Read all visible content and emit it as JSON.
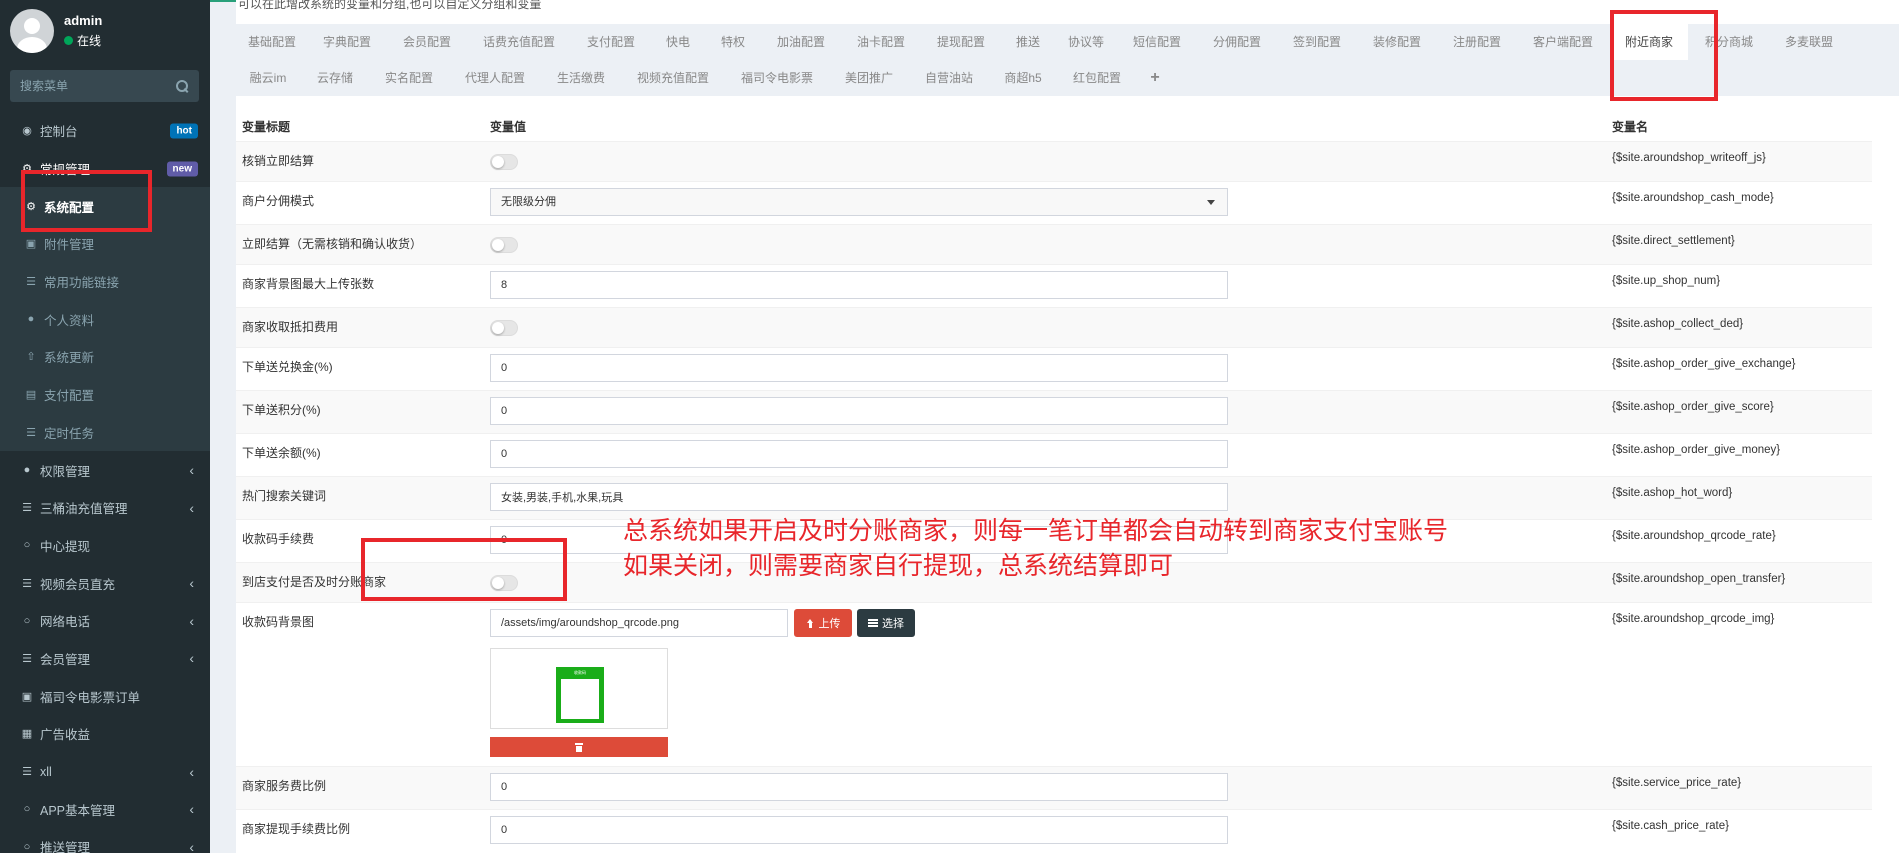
{
  "user": {
    "name": "admin",
    "status": "在线"
  },
  "search": {
    "placeholder": "搜索菜单"
  },
  "menu": [
    {
      "label": "控制台",
      "badge": "hot"
    },
    {
      "label": "常规管理",
      "badge": "new"
    },
    {
      "label": "系统配置"
    },
    {
      "label": "附件管理"
    },
    {
      "label": "常用功能链接"
    },
    {
      "label": "个人资料"
    },
    {
      "label": "系统更新"
    },
    {
      "label": "支付配置"
    },
    {
      "label": "定时任务"
    },
    {
      "label": "权限管理"
    },
    {
      "label": "三桶油充值管理"
    },
    {
      "label": "中心提现"
    },
    {
      "label": "视频会员直充"
    },
    {
      "label": "网络电话"
    },
    {
      "label": "会员管理"
    },
    {
      "label": "福司令电影票订单"
    },
    {
      "label": "广告收益"
    },
    {
      "label": "xll"
    },
    {
      "label": "APP基本管理"
    },
    {
      "label": "推送管理"
    }
  ],
  "page": {
    "description": "可以在此增改系统的变量和分组,也可以自定义分组和变量"
  },
  "tabs": [
    "基础配置",
    "字典配置",
    "会员配置",
    "话费充值配置",
    "支付配置",
    "快电",
    "特权",
    "加油配置",
    "油卡配置",
    "提现配置",
    "推送",
    "协议等",
    "短信配置",
    "分佣配置",
    "签到配置",
    "装修配置",
    "注册配置",
    "客户端配置",
    "附近商家",
    "积分商城",
    "多麦联盟",
    "融云im",
    "云存储",
    "实名配置",
    "代理人配置",
    "生活缴费",
    "视频充值配置",
    "福司令电影票",
    "美团推广",
    "自营油站",
    "商超h5",
    "红包配置",
    "+"
  ],
  "table": {
    "headers": {
      "title": "变量标题",
      "value": "变量值",
      "name": "变量名"
    },
    "rows": [
      {
        "title": "核销立即结算",
        "type": "toggle",
        "name": "{$site.aroundshop_writeoff_js}"
      },
      {
        "title": "商户分佣模式",
        "type": "select",
        "value": "无限级分佣",
        "name": "{$site.aroundshop_cash_mode}"
      },
      {
        "title": "立即结算（无需核销和确认收货）",
        "type": "toggle",
        "name": "{$site.direct_settlement}"
      },
      {
        "title": "商家背景图最大上传张数",
        "type": "input",
        "value": "8",
        "name": "{$site.up_shop_num}"
      },
      {
        "title": "商家收取抵扣费用",
        "type": "toggle",
        "name": "{$site.ashop_collect_ded}"
      },
      {
        "title": "下单送兑换金(%)",
        "type": "input",
        "value": "0",
        "name": "{$site.ashop_order_give_exchange}"
      },
      {
        "title": "下单送积分(%)",
        "type": "input",
        "value": "0",
        "name": "{$site.ashop_order_give_score}"
      },
      {
        "title": "下单送余额(%)",
        "type": "input",
        "value": "0",
        "name": "{$site.ashop_order_give_money}"
      },
      {
        "title": "热门搜索关键词",
        "type": "input",
        "value": "女装,男装,手机,水果,玩具",
        "name": "{$site.ashop_hot_word}"
      },
      {
        "title": "收款码手续费",
        "type": "input",
        "value": "0",
        "name": "{$site.aroundshop_qrcode_rate}"
      },
      {
        "title": "到店支付是否及时分账商家",
        "type": "toggle",
        "name": "{$site.aroundshop_open_transfer}"
      },
      {
        "title": "收款码背景图",
        "type": "image",
        "value": "/assets/img/aroundshop_qrcode.png",
        "upload_label": "上传",
        "choose_label": "选择",
        "name": "{$site.aroundshop_qrcode_img}"
      },
      {
        "title": "商家服务费比例",
        "type": "input",
        "value": "0",
        "name": "{$site.service_price_rate}"
      },
      {
        "title": "商家提现手续费比例",
        "type": "input",
        "value": "0",
        "name": "{$site.cash_price_rate}"
      }
    ]
  },
  "preview_card": {
    "title": "收款码"
  },
  "annotation": {
    "line1": "总系统如果开启及时分账商家，则每一笔订单都会自动转到商家支付宝账号",
    "line2": "如果关闭，则需要商家自行提现，总系统结算即可"
  },
  "colors": {
    "sidebar_bg": "#222d32",
    "accent_red": "#e8262b",
    "upload_red": "#dd4b39",
    "status_green": "#00a65a"
  }
}
